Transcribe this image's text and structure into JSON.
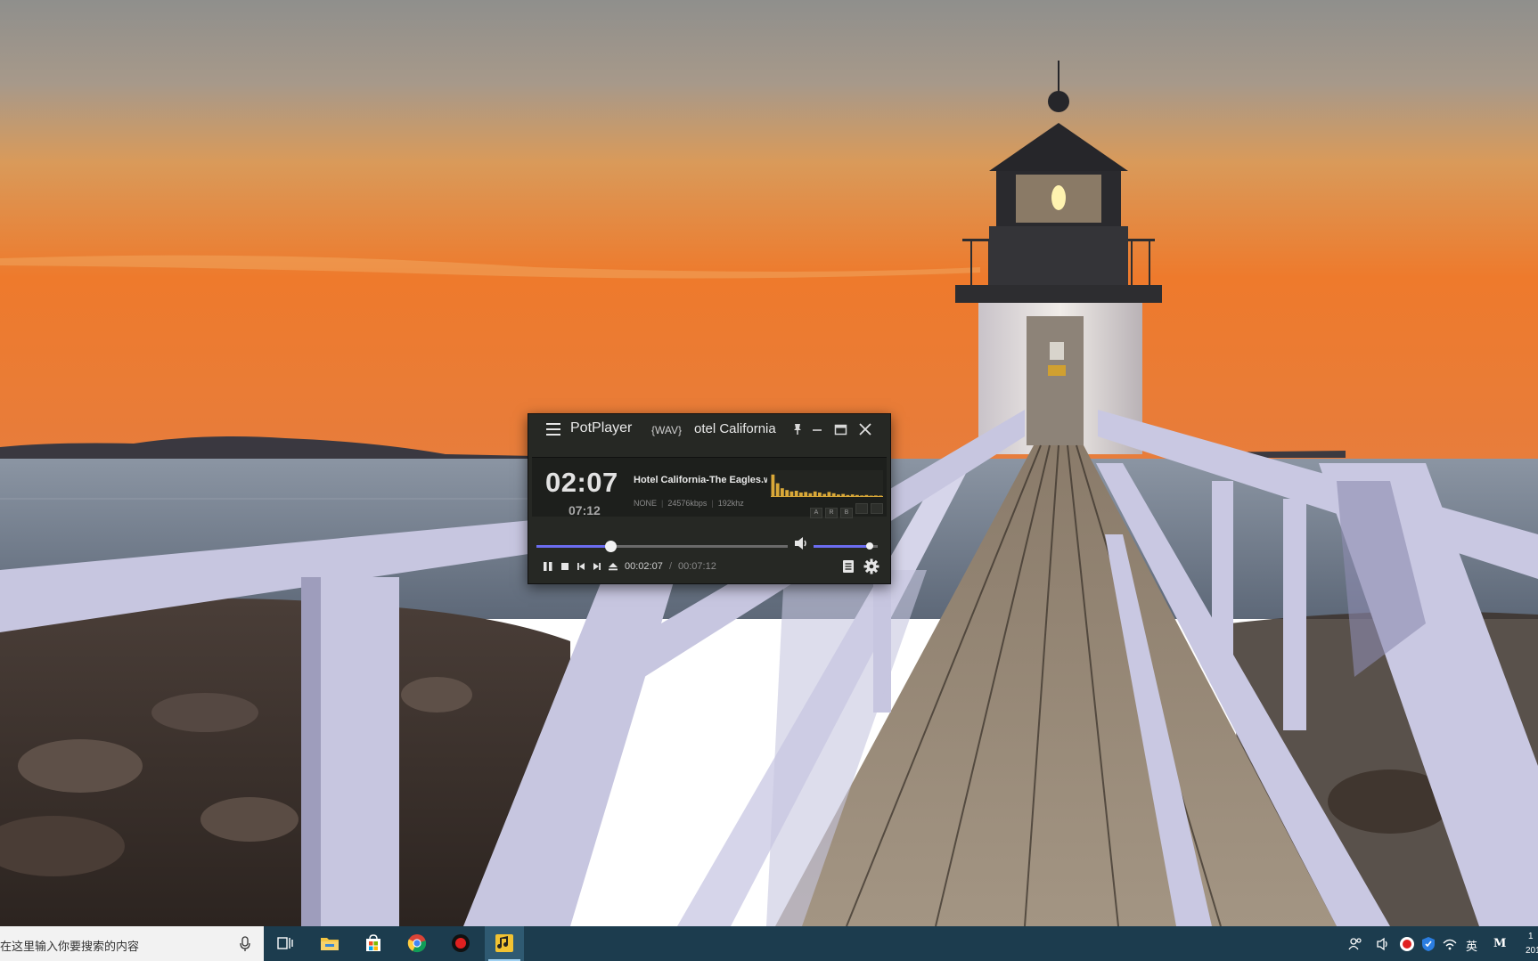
{
  "desktop": {
    "wallpaper_icon": "lighthouse-sunset-photo"
  },
  "player": {
    "app_name": "PotPlayer",
    "format": "{WAV}",
    "title_scroll": "otel California",
    "current_time_big": "02:07",
    "total_time_small": "07:12",
    "track_name": "Hotel California-The Eagles.wav",
    "info": {
      "codec": "NONE",
      "bitrate": "24576kbps",
      "samplerate": "192khz"
    },
    "mini_buttons": [
      "A",
      "R",
      "B",
      "",
      ""
    ],
    "position_time": "00:02:07",
    "separator": "/",
    "duration_time": "00:07:12",
    "progress_fraction": 0.294,
    "volume_fraction": 0.88,
    "spectrum_levels": [
      0.9,
      0.55,
      0.35,
      0.28,
      0.22,
      0.25,
      0.18,
      0.2,
      0.15,
      0.22,
      0.18,
      0.12,
      0.2,
      0.15,
      0.1,
      0.12,
      0.08,
      0.1,
      0.08,
      0.06,
      0.08,
      0.05,
      0.06,
      0.05
    ],
    "accent_color": "#6b6cf0",
    "spectrum_color": "#d9a838",
    "icons": {
      "menu": "hamburger-icon",
      "pin": "pin-icon",
      "minimize": "minimize-icon",
      "maximize": "maximize-icon",
      "close": "close-icon",
      "pause": "pause-icon",
      "stop": "stop-icon",
      "prev": "previous-icon",
      "next": "next-icon",
      "eject": "eject-icon",
      "volume": "speaker-icon",
      "playlist": "playlist-icon",
      "settings": "gear-icon"
    }
  },
  "taskbar": {
    "search_placeholder": "在这里输入你要搜索的内容",
    "pinned": [
      "task-view-icon",
      "file-explorer-icon",
      "microsoft-store-icon",
      "chrome-icon",
      "record-app-icon",
      "potplayer-icon"
    ],
    "tray": {
      "language": "英",
      "ime": "M"
    },
    "clock_line1": "1",
    "clock_line2": "201"
  }
}
